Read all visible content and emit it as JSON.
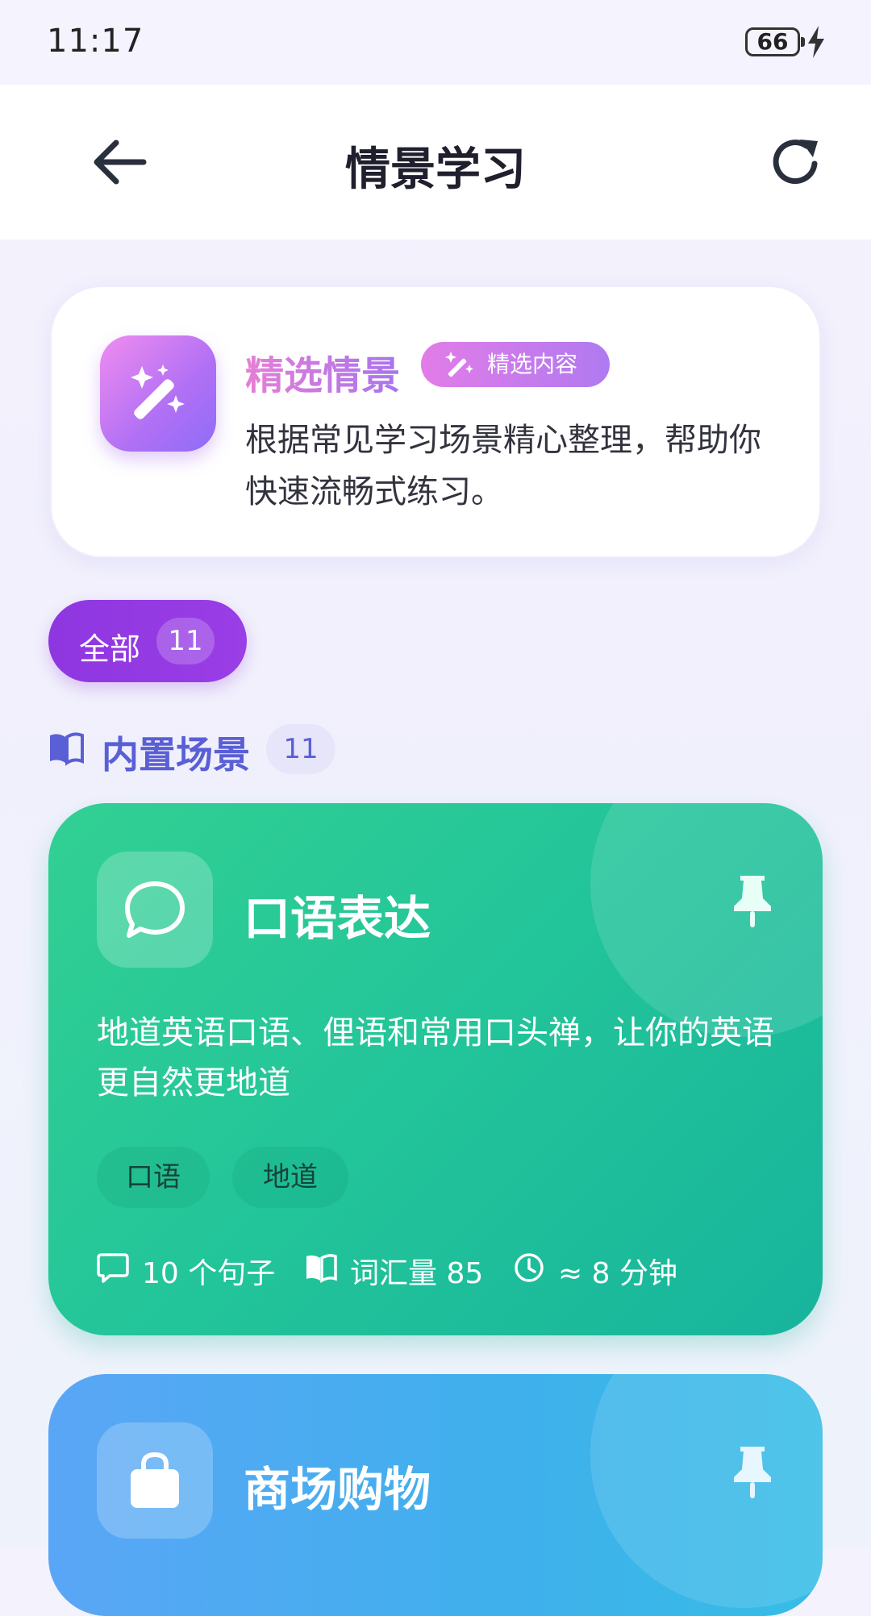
{
  "status_bar": {
    "time": "11:17",
    "battery": "66"
  },
  "navbar": {
    "title": "情景学习"
  },
  "intro": {
    "title": "精选情景",
    "badge": "精选内容",
    "description": "根据常见学习场景精心整理，帮助你快速流畅式练习。"
  },
  "filter": {
    "label": "全部",
    "count": "11"
  },
  "section": {
    "title": "内置场景",
    "count": "11"
  },
  "scenes": [
    {
      "title": "口语表达",
      "description": "地道英语口语、俚语和常用口头禅，让你的英语更自然更地道",
      "tags": [
        "口语",
        "地道"
      ],
      "sentences": "10 个句子",
      "vocabulary": "词汇量 85",
      "duration": "≈ 8 分钟",
      "color": "#22c49a"
    },
    {
      "title": "商场购物",
      "color": "#3fb0ec"
    }
  ]
}
